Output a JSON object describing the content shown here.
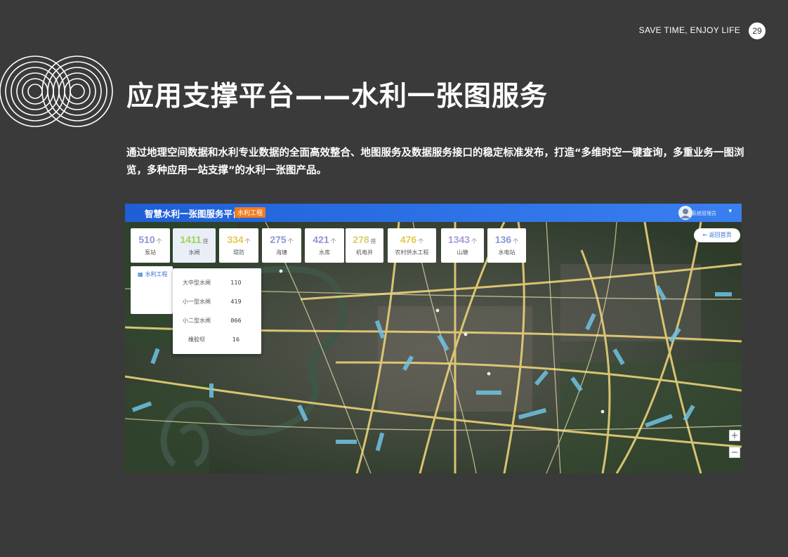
{
  "tagline": "SAVE TIME, ENJOY LIFE",
  "page_number": "29",
  "title": "应用支撑平台——水利一张图服务",
  "description": "通过地理空间数据和水利专业数据的全面高效整合、地图服务及数据服务接口的稳定标准发布，打造“多维时空一键查询，多重业务一图浏览，多种应用一站支撑”的水利一张图产品。",
  "app": {
    "title": "智慧水利一张图服务平台",
    "tag": "水利工程",
    "user_name": "系统管理员",
    "return_label": "返回首页",
    "panel_title": "水利工程",
    "panel_icon": "grid-icon",
    "zoom_in": "+",
    "zoom_out": "−"
  },
  "stats": [
    {
      "value": "510",
      "unit": "个",
      "label": "泵站",
      "color": "#8d97d6"
    },
    {
      "value": "1411",
      "unit": "座",
      "label": "水闸",
      "color": "#9ad64a"
    },
    {
      "value": "334",
      "unit": "个",
      "label": "堤防",
      "color": "#e6c84a"
    },
    {
      "value": "275",
      "unit": "个",
      "label": "海塘",
      "color": "#8d97d6"
    },
    {
      "value": "421",
      "unit": "个",
      "label": "水库",
      "color": "#8d97d6"
    },
    {
      "value": "278",
      "unit": "座",
      "label": "机电井",
      "color": "#d8cf6a"
    },
    {
      "value": "476",
      "unit": "个",
      "label": "农村供水工程",
      "color": "#e6c84a"
    },
    {
      "value": "1343",
      "unit": "个",
      "label": "山塘",
      "color": "#a99ad8"
    },
    {
      "value": "136",
      "unit": "个",
      "label": "水电站",
      "color": "#8d97d6"
    }
  ],
  "sluice_breakdown": [
    {
      "name": "大中型水闸",
      "value": "110"
    },
    {
      "name": "小一型水闸",
      "value": "419"
    },
    {
      "name": "小二型水闸",
      "value": "866"
    },
    {
      "name": "橡胶坝",
      "value": "16"
    }
  ],
  "colors": {
    "background": "#3a3a3a",
    "header_blue": "#2f74e8",
    "tag_orange": "#f07d1c"
  }
}
